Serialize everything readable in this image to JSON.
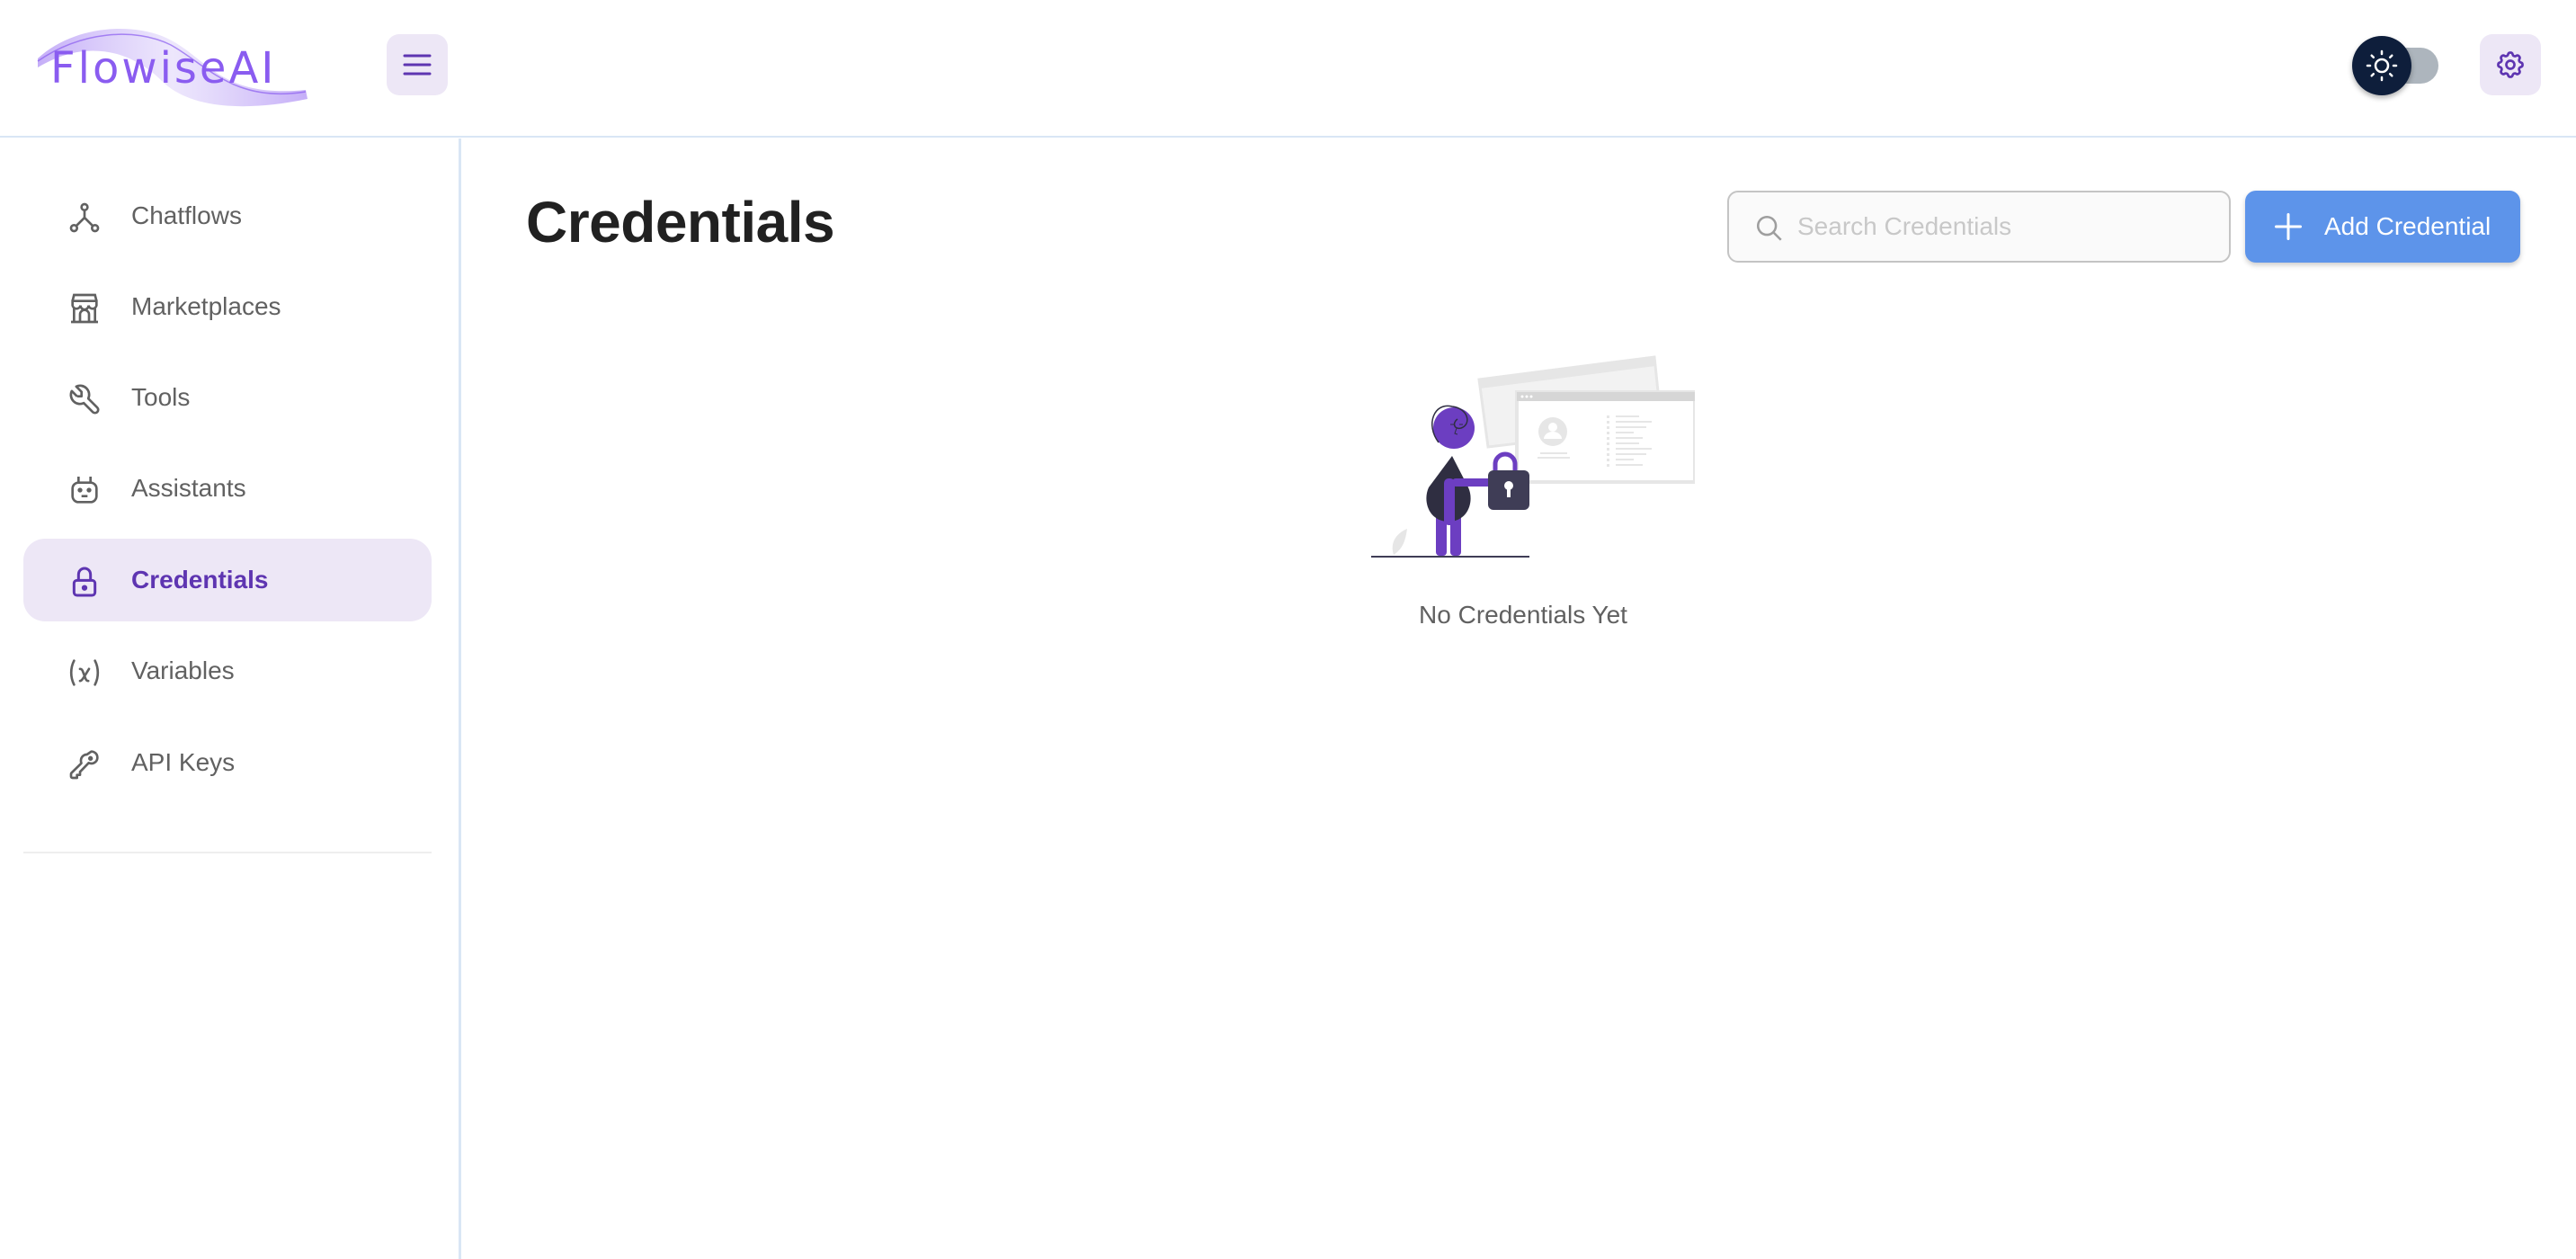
{
  "app": {
    "brand": "FlowiseAI",
    "accent_color": "#5e35b1",
    "primary_button_color": "#5d94ea"
  },
  "header": {
    "menu_icon": "hamburger-menu-icon",
    "theme_toggle": {
      "icon": "sun-icon",
      "dark_mode": false
    },
    "settings_icon": "gear-icon"
  },
  "sidebar": {
    "items": [
      {
        "label": "Chatflows",
        "icon": "hierarchy-icon",
        "active": false
      },
      {
        "label": "Marketplaces",
        "icon": "storefront-icon",
        "active": false
      },
      {
        "label": "Tools",
        "icon": "wrench-icon",
        "active": false
      },
      {
        "label": "Assistants",
        "icon": "robot-icon",
        "active": false
      },
      {
        "label": "Credentials",
        "icon": "lock-icon",
        "active": true
      },
      {
        "label": "Variables",
        "icon": "variable-icon",
        "active": false
      },
      {
        "label": "API Keys",
        "icon": "key-icon",
        "active": false
      }
    ]
  },
  "main": {
    "title": "Credentials",
    "search": {
      "placeholder": "Search Credentials",
      "value": ""
    },
    "add_button_label": "Add Credential",
    "empty_state": {
      "illustration": "person-with-padlock-illustration",
      "message": "No Credentials Yet"
    }
  }
}
